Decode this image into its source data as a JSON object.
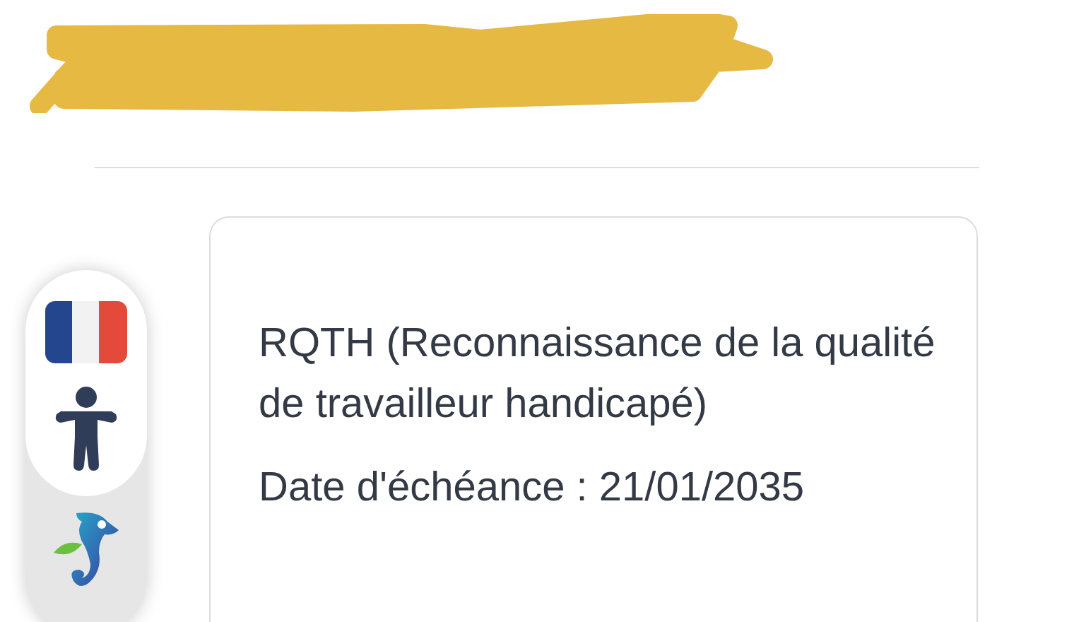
{
  "card": {
    "title": "RQTH (Reconnaissance de la qualité de travailleur handicapé)",
    "expiry": "Date d'échéance : 21/01/2035"
  }
}
